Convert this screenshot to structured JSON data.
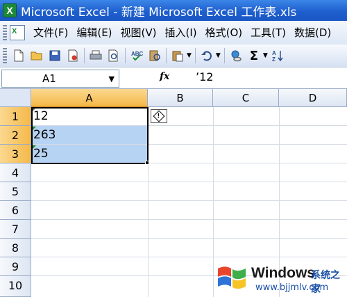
{
  "window": {
    "title": "Microsoft Excel - 新建 Microsoft Excel 工作表.xls",
    "app_icon": "X"
  },
  "menu": [
    "文件(F)",
    "编辑(E)",
    "视图(V)",
    "插入(I)",
    "格式(O)",
    "工具(T)",
    "数据(D)"
  ],
  "toolbar": {
    "icons": [
      "new-icon",
      "open-icon",
      "save-icon",
      "permission-icon",
      "print-icon",
      "print-preview-icon",
      "spelling-icon",
      "research-icon",
      "paste-icon",
      "undo-icon",
      "hyperlink-icon",
      "autosum-icon",
      "sort-ascending-icon"
    ],
    "autosum_glyph": "Σ"
  },
  "formula_bar": {
    "name_box": "A1",
    "fx_label": "fx",
    "formula": "’12"
  },
  "columns": [
    "A",
    "B",
    "C",
    "D"
  ],
  "rows": [
    "1",
    "2",
    "3",
    "4",
    "5",
    "6",
    "7",
    "8",
    "9",
    "10"
  ],
  "cells": {
    "A1": "12",
    "A2": "263",
    "A3": "25"
  },
  "smart_tag_glyph": "!",
  "watermark": {
    "title": "Windows",
    "subtitle": "系统之家",
    "url": "www.bjjmlv.com"
  },
  "colors": {
    "title_bar": "#1f5fce",
    "selection": "#b7d3f3",
    "active_header": "#f5b94a",
    "error_triangle": "#1b8a30"
  }
}
